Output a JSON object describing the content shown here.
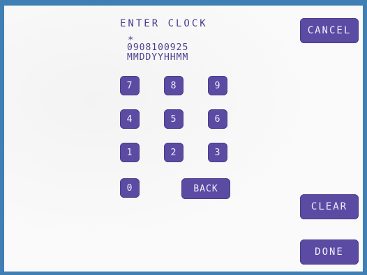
{
  "header": {
    "title": "ENTER CLOCK",
    "indicator": "*",
    "entry_value": "0908100925",
    "format": "MMDDYYHHMM"
  },
  "keypad": {
    "k7": "7",
    "k8": "8",
    "k9": "9",
    "k4": "4",
    "k5": "5",
    "k6": "6",
    "k1": "1",
    "k2": "2",
    "k3": "3",
    "k0": "0",
    "back": "BACK"
  },
  "actions": {
    "cancel": "CANCEL",
    "clear": "CLEAR",
    "done": "DONE"
  },
  "colors": {
    "button": "#5b4ba2",
    "text": "#4b3e8e",
    "background": "#fafafa",
    "frame": "#3f7fb3"
  }
}
